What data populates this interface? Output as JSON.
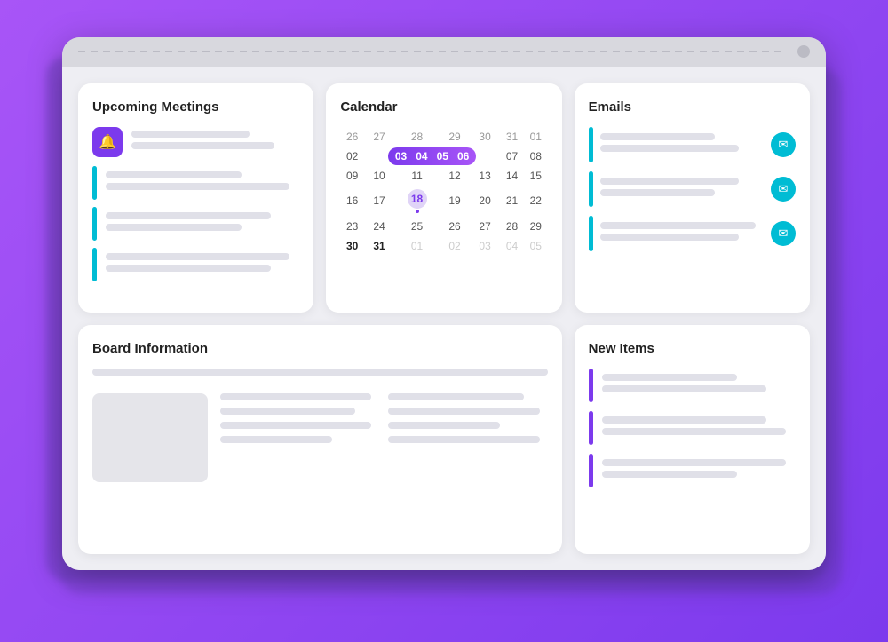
{
  "device": {
    "top_bar": {
      "dot_label": "camera dot"
    }
  },
  "meetings": {
    "title": "Upcoming Meetings",
    "bell_icon": "🔔",
    "items": [
      {
        "bar_lines": [
          "short",
          "medium"
        ]
      },
      {
        "bar_lines": [
          "medium",
          "long"
        ]
      },
      {
        "bar_lines": [
          "short",
          "medium"
        ]
      },
      {
        "bar_lines": [
          "medium",
          "short"
        ]
      }
    ]
  },
  "calendar": {
    "title": "Calendar",
    "headers": [
      "26",
      "27",
      "28",
      "29",
      "30",
      "31",
      "01"
    ],
    "rows": [
      [
        "02",
        "03",
        "04",
        "05",
        "06",
        "07",
        "08"
      ],
      [
        "09",
        "10",
        "11",
        "12",
        "13",
        "14",
        "15"
      ],
      [
        "16",
        "17",
        "18",
        "19",
        "20",
        "21",
        "22"
      ],
      [
        "23",
        "24",
        "25",
        "26",
        "27",
        "28",
        "29"
      ],
      [
        "30",
        "31",
        "01",
        "02",
        "03",
        "04",
        "05"
      ]
    ],
    "highlight_range": [
      1,
      2,
      3,
      4
    ],
    "highlight_today_row": 2,
    "highlight_today_col": 4,
    "dot_row": 2,
    "dot_col": 4,
    "highlight_18_row": 2,
    "highlight_18_col": 1
  },
  "emails": {
    "title": "Emails",
    "items": [
      {
        "line1": "",
        "line2": ""
      },
      {
        "line1": "",
        "line2": ""
      },
      {
        "line1": "",
        "line2": ""
      }
    ],
    "email_icon": "✉"
  },
  "board": {
    "title": "Board Information",
    "cols": [
      [
        "",
        "",
        "",
        ""
      ],
      [
        "",
        "",
        "",
        ""
      ]
    ]
  },
  "new_items": {
    "title": "New Items",
    "items": [
      {
        "line1": "",
        "line2": ""
      },
      {
        "line1": "",
        "line2": ""
      },
      {
        "line1": "",
        "line2": ""
      }
    ]
  },
  "colors": {
    "purple": "#7c3aed",
    "teal": "#00bcd4",
    "light_gray": "#e0e0e8",
    "dark_gray": "#555"
  }
}
